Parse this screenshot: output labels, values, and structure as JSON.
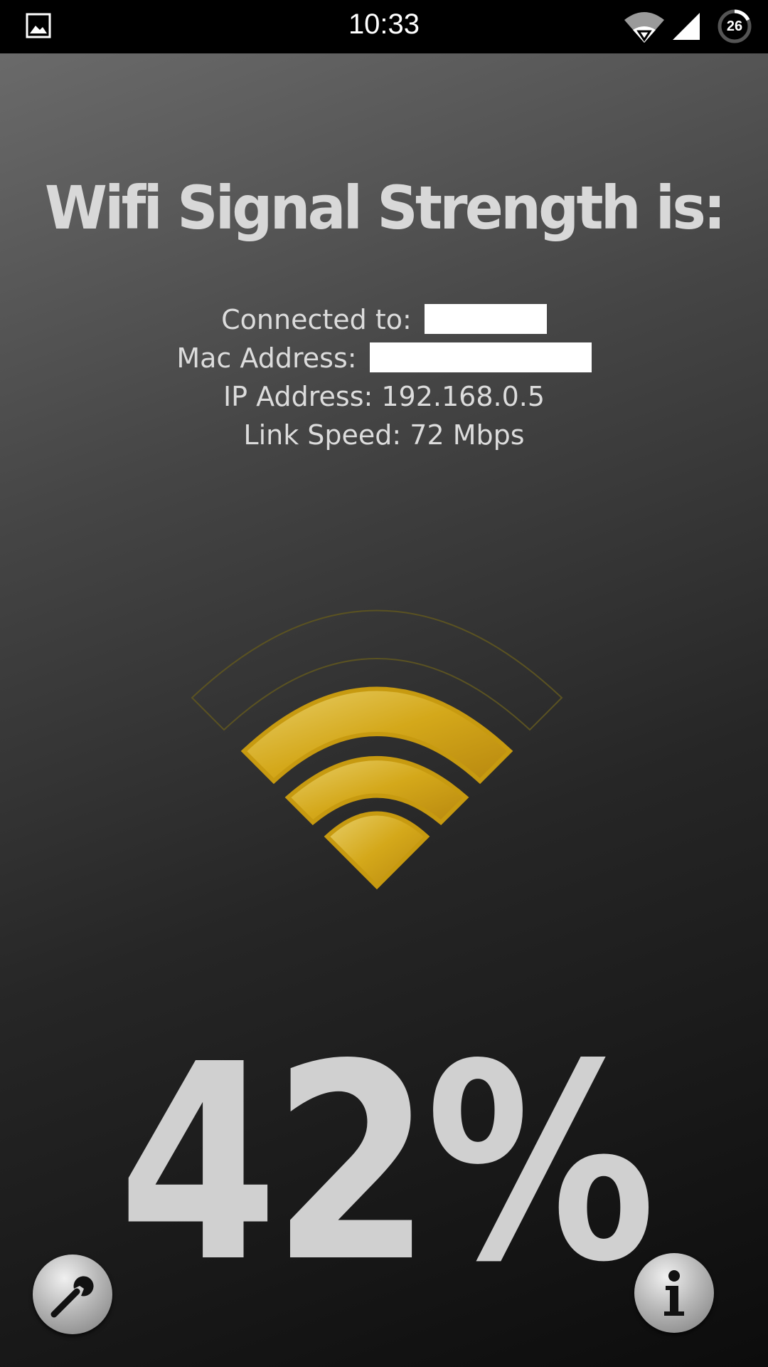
{
  "status_bar": {
    "time": "10:33",
    "battery_level": "26",
    "icons": [
      "gallery-icon",
      "wifi-icon",
      "cell-signal-icon",
      "battery-icon"
    ]
  },
  "main": {
    "headline": "Wifi Signal Strength is:",
    "connected_label": "Connected to:",
    "mac_label": "Mac Address:",
    "ip_text": "IP Address: 192.168.0.5",
    "link_speed_text": "Link Speed: 72 Mbps",
    "signal_percent_text": "42%",
    "signal_level": 0.42
  },
  "buttons": {
    "settings_icon": "wrench-icon",
    "info_icon": "info-icon"
  },
  "colors": {
    "accent": "#d4a81a",
    "text": "#d8d8d8",
    "status_bar": "#000000"
  }
}
